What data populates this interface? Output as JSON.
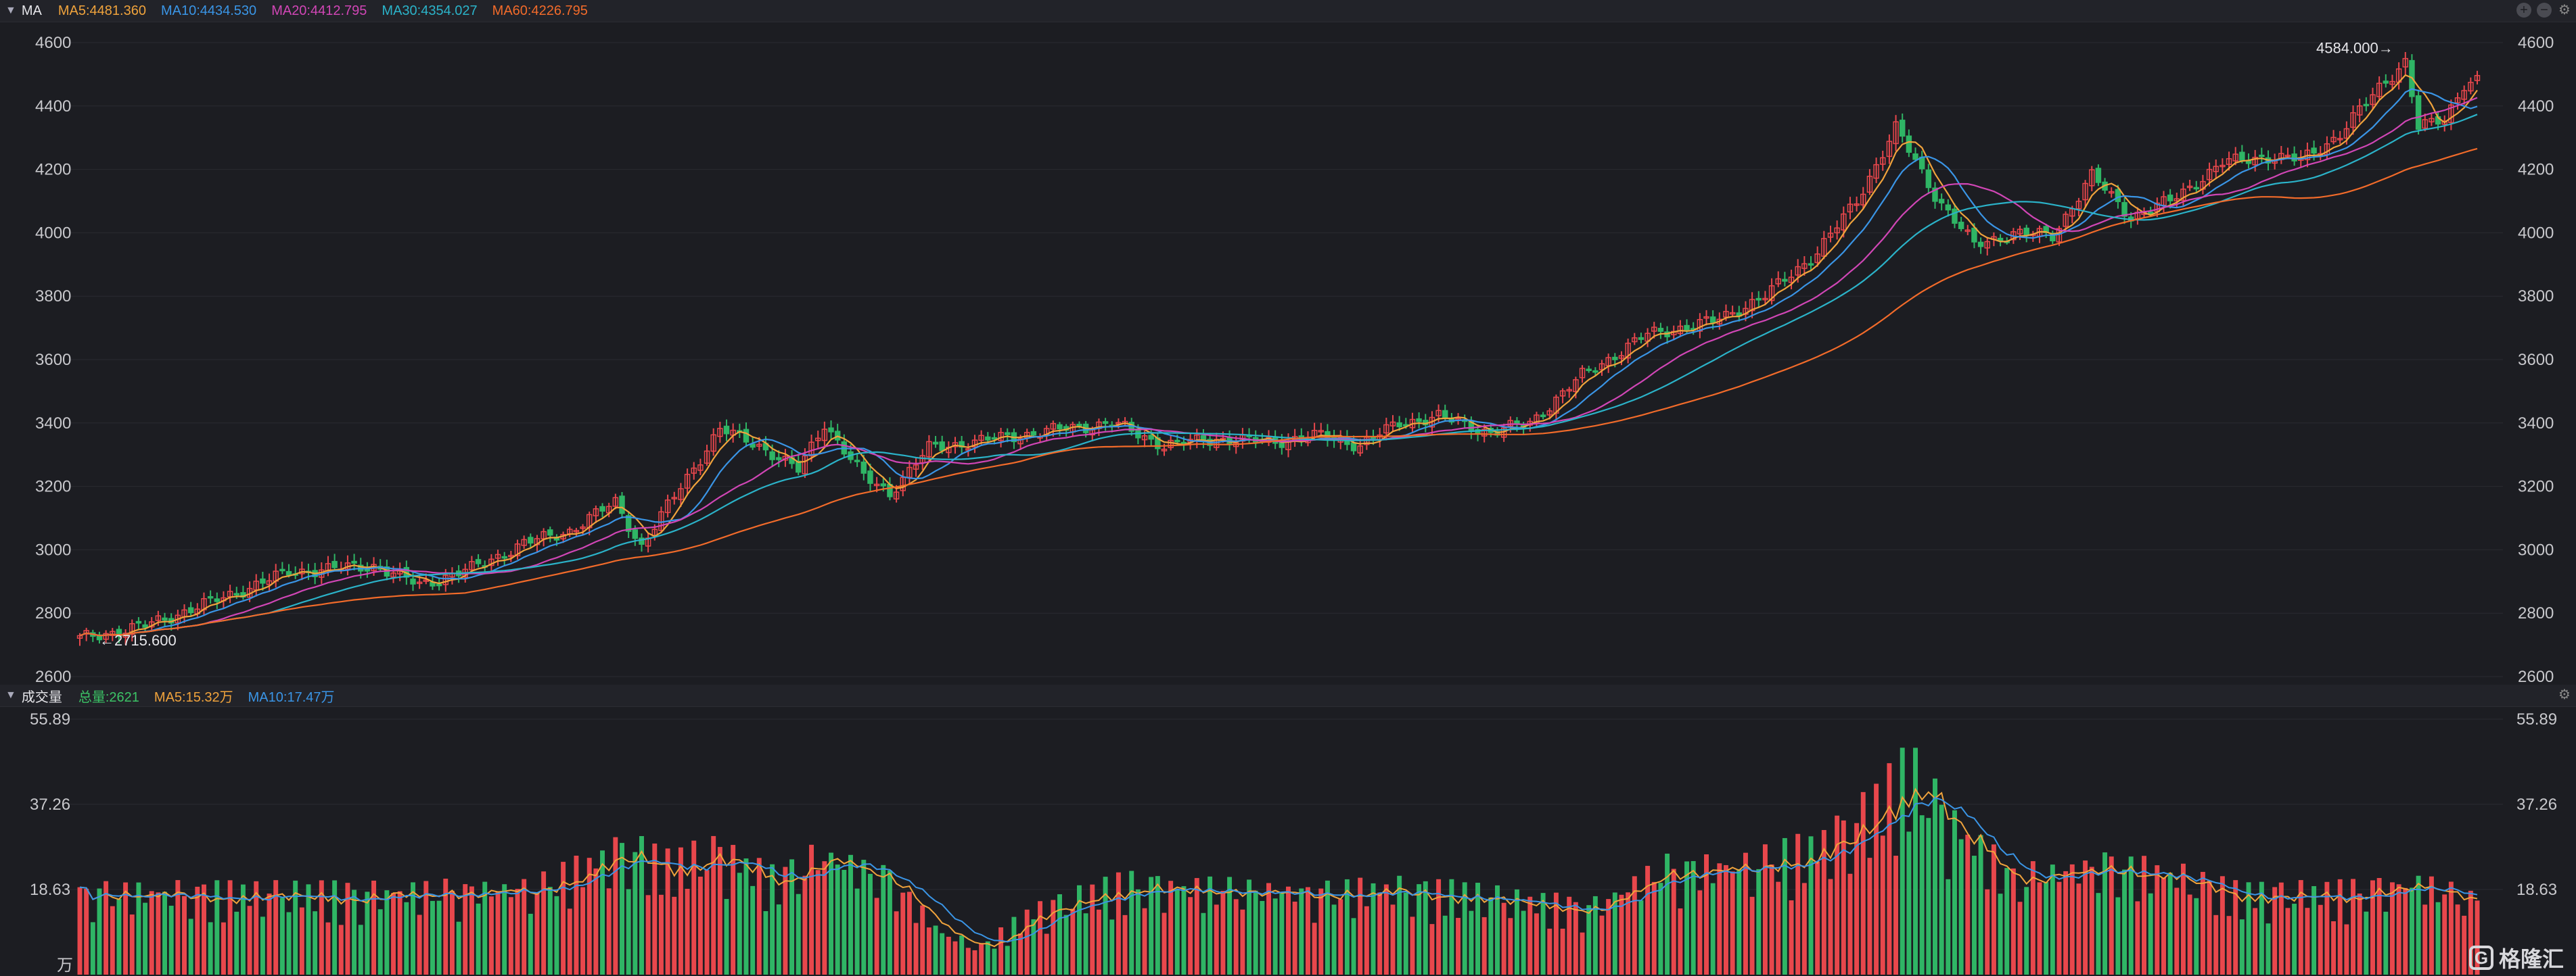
{
  "price_header": {
    "title": "MA",
    "items": [
      {
        "label": "MA5:4481.360",
        "color": "#f0a33c"
      },
      {
        "label": "MA10:4434.530",
        "color": "#3a95e6"
      },
      {
        "label": "MA20:4412.795",
        "color": "#d146b6"
      },
      {
        "label": "MA30:4354.027",
        "color": "#2bb3c9"
      },
      {
        "label": "MA60:4226.795",
        "color": "#f26b2a"
      }
    ]
  },
  "volume_header": {
    "title": "成交量",
    "items": [
      {
        "label": "总量:2621",
        "color": "#3cc466"
      },
      {
        "label": "MA5:15.32万",
        "color": "#f0a33c"
      },
      {
        "label": "MA10:17.47万",
        "color": "#3a95e6"
      }
    ]
  },
  "colors": {
    "up": "#e8474c",
    "down": "#2fb565",
    "grid": "#2a2b31",
    "axis_text": "#c8c8cc"
  },
  "logo_text": "格隆汇",
  "chart_data": [
    {
      "type": "candlestick",
      "ylim": [
        2600,
        4600
      ],
      "y_ticks": [
        "4600",
        "4400",
        "4200",
        "4000",
        "3800",
        "3600",
        "3400",
        "3200",
        "3000",
        "2800",
        "2600"
      ],
      "annotations": [
        {
          "text": "4584.000→",
          "value": 4584
        },
        {
          "text": "←2715.600",
          "value": 2715.6
        }
      ],
      "anchors": [
        {
          "i": 0,
          "v": 2720
        },
        {
          "i": 10,
          "v": 2760
        },
        {
          "i": 22,
          "v": 2850
        },
        {
          "i": 32,
          "v": 2930
        },
        {
          "i": 45,
          "v": 2950
        },
        {
          "i": 52,
          "v": 2890
        },
        {
          "i": 60,
          "v": 2940
        },
        {
          "i": 68,
          "v": 3020
        },
        {
          "i": 75,
          "v": 3060
        },
        {
          "i": 82,
          "v": 3150
        },
        {
          "i": 86,
          "v": 3010
        },
        {
          "i": 92,
          "v": 3200
        },
        {
          "i": 98,
          "v": 3380
        },
        {
          "i": 104,
          "v": 3330
        },
        {
          "i": 110,
          "v": 3250
        },
        {
          "i": 114,
          "v": 3400
        },
        {
          "i": 120,
          "v": 3230
        },
        {
          "i": 124,
          "v": 3180
        },
        {
          "i": 130,
          "v": 3320
        },
        {
          "i": 140,
          "v": 3350
        },
        {
          "i": 150,
          "v": 3380
        },
        {
          "i": 158,
          "v": 3400
        },
        {
          "i": 166,
          "v": 3330
        },
        {
          "i": 174,
          "v": 3350
        },
        {
          "i": 182,
          "v": 3340
        },
        {
          "i": 190,
          "v": 3360
        },
        {
          "i": 196,
          "v": 3330
        },
        {
          "i": 202,
          "v": 3400
        },
        {
          "i": 208,
          "v": 3420
        },
        {
          "i": 216,
          "v": 3370
        },
        {
          "i": 222,
          "v": 3400
        },
        {
          "i": 230,
          "v": 3550
        },
        {
          "i": 240,
          "v": 3680
        },
        {
          "i": 250,
          "v": 3720
        },
        {
          "i": 258,
          "v": 3800
        },
        {
          "i": 266,
          "v": 3940
        },
        {
          "i": 272,
          "v": 4100
        },
        {
          "i": 278,
          "v": 4330
        },
        {
          "i": 284,
          "v": 4120
        },
        {
          "i": 290,
          "v": 3960
        },
        {
          "i": 296,
          "v": 4000
        },
        {
          "i": 302,
          "v": 3990
        },
        {
          "i": 308,
          "v": 4180
        },
        {
          "i": 314,
          "v": 4050
        },
        {
          "i": 320,
          "v": 4100
        },
        {
          "i": 328,
          "v": 4220
        },
        {
          "i": 334,
          "v": 4240
        },
        {
          "i": 340,
          "v": 4230
        },
        {
          "i": 346,
          "v": 4310
        },
        {
          "i": 352,
          "v": 4460
        },
        {
          "i": 356,
          "v": 4540
        },
        {
          "i": 358,
          "v": 4330
        },
        {
          "i": 362,
          "v": 4360
        },
        {
          "i": 365,
          "v": 4470
        },
        {
          "i": 367,
          "v": 4480
        }
      ]
    },
    {
      "type": "bar",
      "ylim": [
        0,
        55.89
      ],
      "y_ticks": [
        "55.89",
        "37.26",
        "18.63"
      ],
      "unit": "万",
      "anchors": [
        {
          "i": 0,
          "v": 18
        },
        {
          "i": 20,
          "v": 18
        },
        {
          "i": 50,
          "v": 18
        },
        {
          "i": 70,
          "v": 19
        },
        {
          "i": 84,
          "v": 28
        },
        {
          "i": 90,
          "v": 24
        },
        {
          "i": 98,
          "v": 27
        },
        {
          "i": 106,
          "v": 21
        },
        {
          "i": 114,
          "v": 26
        },
        {
          "i": 124,
          "v": 21
        },
        {
          "i": 132,
          "v": 9
        },
        {
          "i": 138,
          "v": 6
        },
        {
          "i": 146,
          "v": 14
        },
        {
          "i": 160,
          "v": 20
        },
        {
          "i": 170,
          "v": 19
        },
        {
          "i": 190,
          "v": 18
        },
        {
          "i": 200,
          "v": 19
        },
        {
          "i": 212,
          "v": 18
        },
        {
          "i": 222,
          "v": 16
        },
        {
          "i": 232,
          "v": 15
        },
        {
          "i": 242,
          "v": 23
        },
        {
          "i": 256,
          "v": 24
        },
        {
          "i": 266,
          "v": 28
        },
        {
          "i": 274,
          "v": 36
        },
        {
          "i": 280,
          "v": 45
        },
        {
          "i": 286,
          "v": 34
        },
        {
          "i": 296,
          "v": 21
        },
        {
          "i": 310,
          "v": 24
        },
        {
          "i": 320,
          "v": 22
        },
        {
          "i": 330,
          "v": 18
        },
        {
          "i": 345,
          "v": 18
        },
        {
          "i": 358,
          "v": 20
        },
        {
          "i": 367,
          "v": 16
        }
      ]
    }
  ]
}
